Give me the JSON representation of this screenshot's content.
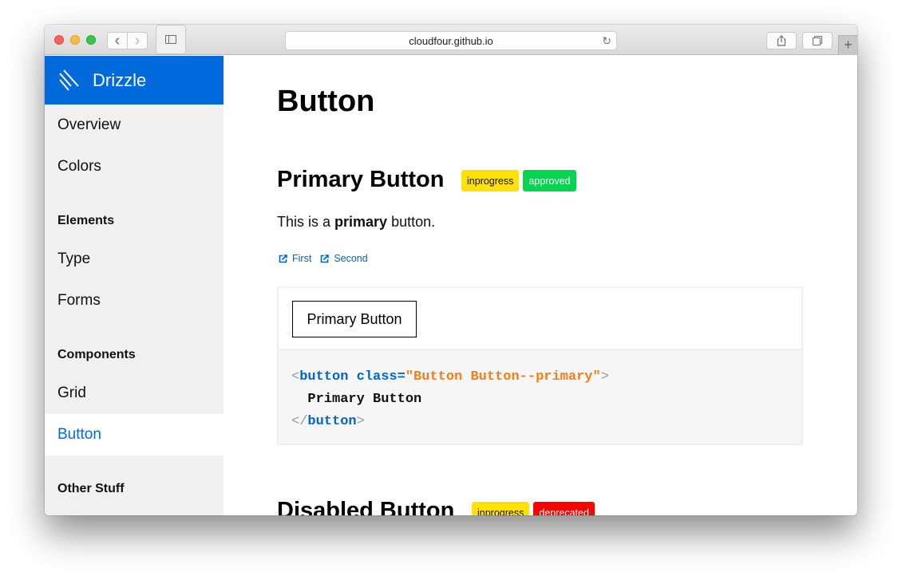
{
  "browser": {
    "url": "cloudfour.github.io",
    "buttons": {
      "back": "‹",
      "forward": "›",
      "reload": "↻",
      "share": "⇪",
      "new_tab": "+"
    },
    "icons": [
      "close-icon",
      "minimize-icon",
      "zoom-icon",
      "back-icon",
      "forward-icon",
      "sidebar-icon",
      "reload-icon",
      "share-icon",
      "tabs-icon",
      "new-tab-icon"
    ]
  },
  "sidebar": {
    "brand": "Drizzle",
    "brand_color": "#006adc",
    "items": [
      {
        "type": "link",
        "label": "Overview"
      },
      {
        "type": "link",
        "label": "Colors"
      },
      {
        "type": "heading",
        "label": "Elements"
      },
      {
        "type": "link",
        "label": "Type"
      },
      {
        "type": "link",
        "label": "Forms"
      },
      {
        "type": "heading",
        "label": "Components"
      },
      {
        "type": "link",
        "label": "Grid"
      },
      {
        "type": "link",
        "label": "Button",
        "active": true
      },
      {
        "type": "heading",
        "label": "Other Stuff"
      }
    ]
  },
  "main": {
    "title": "Button",
    "sections": [
      {
        "title": "Primary Button",
        "badges": [
          {
            "label": "inprogress",
            "color": "#ffe200"
          },
          {
            "label": "approved",
            "color": "#00d74e"
          }
        ],
        "description_pre": "This is a ",
        "description_bold": "primary",
        "description_post": " button.",
        "links": [
          "First",
          "Second"
        ],
        "demo_button_label": "Primary Button",
        "code": {
          "open_lt": "<",
          "tag": "button",
          "attr": " class=",
          "value": "\"Button Button--primary\"",
          "open_gt": ">",
          "inner": "  Primary Button",
          "close_lt": "</",
          "close_gt": ">"
        }
      },
      {
        "title": "Disabled Button",
        "badges": [
          {
            "label": "inprogress",
            "color": "#ffe200"
          },
          {
            "label": "deprecated",
            "color": "#ff0000"
          }
        ]
      }
    ]
  }
}
